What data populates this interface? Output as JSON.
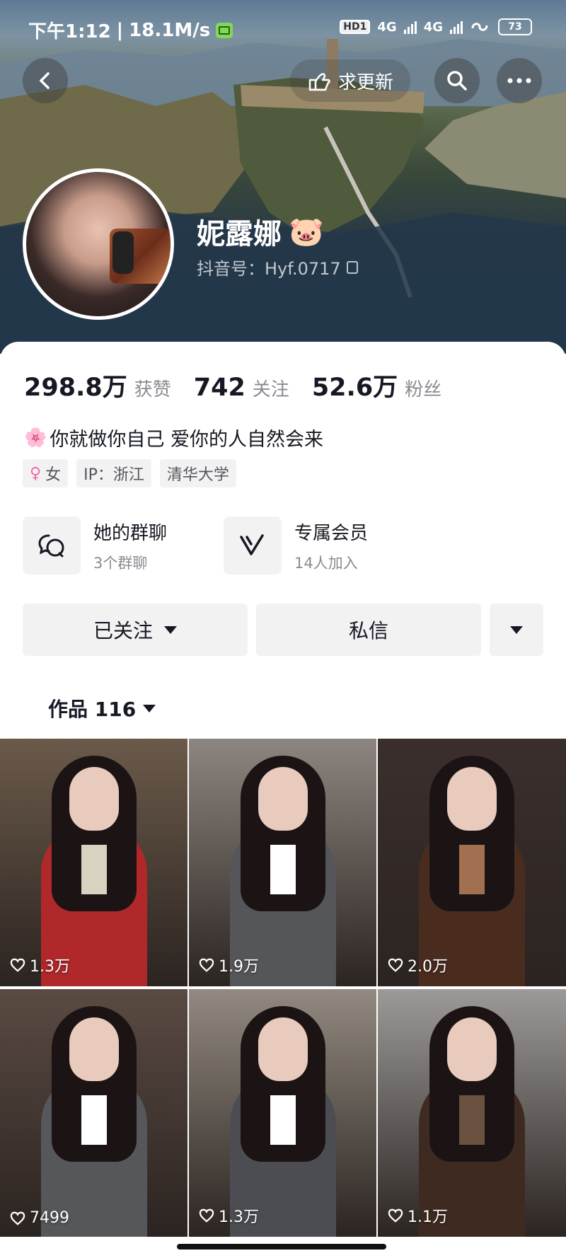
{
  "status_bar": {
    "time": "下午1:12",
    "separator": "|",
    "speed": "18.1M/s",
    "hd": "HD1",
    "net1": "4G",
    "net2": "4G",
    "battery": "73"
  },
  "header": {
    "update_label": "求更新"
  },
  "profile": {
    "name": "妮露娜",
    "name_emoji": "🐷",
    "douyin_id": "抖音号：Hyf.0717"
  },
  "stats": [
    {
      "value": "298.8万",
      "label": "获赞"
    },
    {
      "value": "742",
      "label": "关注"
    },
    {
      "value": "52.6万",
      "label": "粉丝"
    }
  ],
  "bio": {
    "emoji": "🌸",
    "text": "你就做你自己  爱你的人自然会来"
  },
  "tags": {
    "gender": "女",
    "ip": "IP：浙江",
    "school": "清华大学"
  },
  "features": {
    "groups_title": "她的群聊",
    "groups_sub": "3个群聊",
    "member_title": "专属会员",
    "member_sub": "14人加入"
  },
  "actions": {
    "follow_label": "已关注",
    "message_label": "私信"
  },
  "works": {
    "tab_label": "作品 116"
  },
  "videos": [
    {
      "likes": "1.3万",
      "bg": "#6b5a4a",
      "outfit": "#b0282a",
      "accent": "#d8d3c0"
    },
    {
      "likes": "1.9万",
      "bg": "#8d8680",
      "outfit": "#55565a",
      "accent": "#ffffff"
    },
    {
      "likes": "2.0万",
      "bg": "#3a2f2c",
      "outfit": "#4a2c1f",
      "accent": "#a07050"
    },
    {
      "likes": "7499",
      "bg": "#5a4a42",
      "outfit": "#56575b",
      "accent": "#ffffff"
    },
    {
      "likes": "1.3万",
      "bg": "#928a80",
      "outfit": "#4c4d52",
      "accent": "#ffffff"
    },
    {
      "likes": "1.1万",
      "bg": "#9c9a98",
      "outfit": "#3e2a20",
      "accent": "#6a5140"
    }
  ]
}
